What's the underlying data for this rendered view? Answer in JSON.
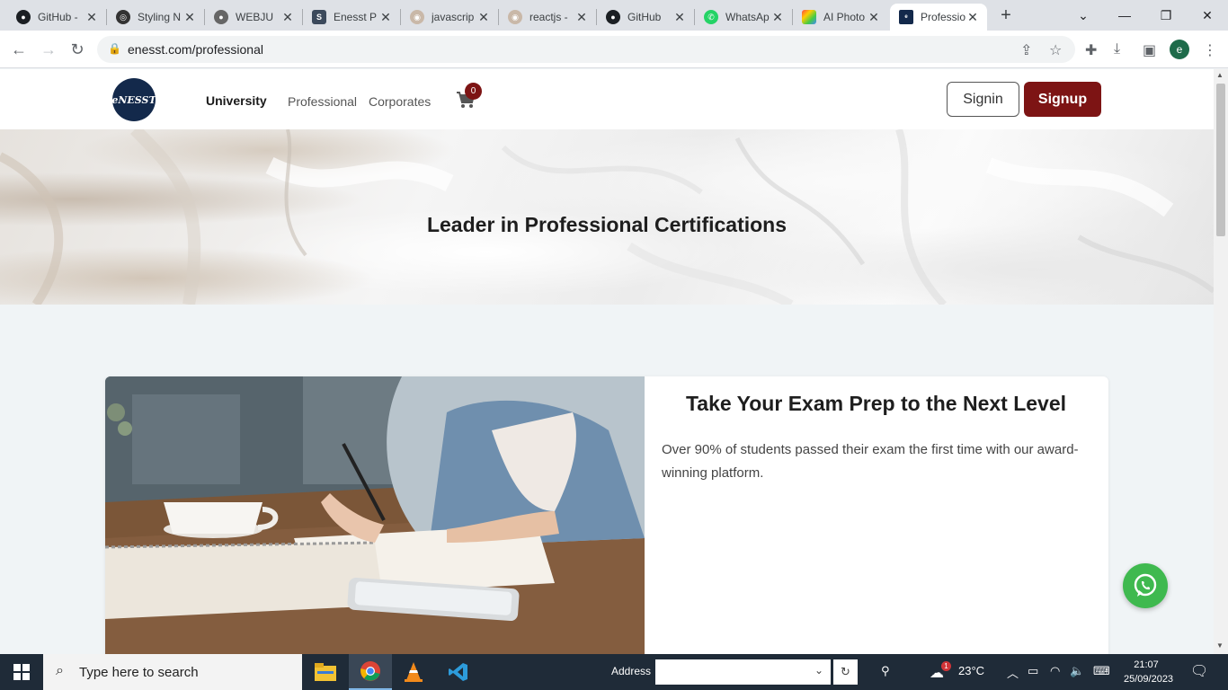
{
  "browser": {
    "tabs": [
      {
        "title": "GitHub - ",
        "favicon": "github-icon"
      },
      {
        "title": "Styling N",
        "favicon": "styling-icon"
      },
      {
        "title": "WEBJU",
        "favicon": "github-icon"
      },
      {
        "title": "Enesst P",
        "favicon": "enesst-s-icon"
      },
      {
        "title": "javascrip",
        "favicon": "stackoverflow-icon"
      },
      {
        "title": "reactjs - ",
        "favicon": "stackoverflow-icon"
      },
      {
        "title": "GitHub",
        "favicon": "github-icon"
      },
      {
        "title": "WhatsAp",
        "favicon": "whatsapp-icon"
      },
      {
        "title": "AI Photo",
        "favicon": "ai-photo-icon"
      },
      {
        "title": "Professio",
        "favicon": "enesst-logo-icon",
        "active": true
      }
    ],
    "new_tab": "+",
    "url": "enesst.com/professional",
    "profile_initial": "e"
  },
  "site": {
    "logo_text": "eNESST",
    "nav": {
      "university": "University",
      "professional": "Professional",
      "corporates": "Corporates"
    },
    "cart_count": "0",
    "signin": "Signin",
    "signup": "Signup",
    "hero_title": "Leader in Professional Certifications",
    "card": {
      "title": "Take Your Exam Prep to the Next Level",
      "text": "Over 90% of students passed their exam the first time with our award-winning platform."
    }
  },
  "colors": {
    "brand": "#7d1414",
    "logo_bg": "#13294b",
    "whatsapp": "#3fb94f"
  },
  "taskbar": {
    "search_placeholder": "Type here to search",
    "address_label": "Address",
    "weather": "23°C",
    "weather_badge": "1",
    "time": "21:07",
    "date": "25/09/2023"
  }
}
